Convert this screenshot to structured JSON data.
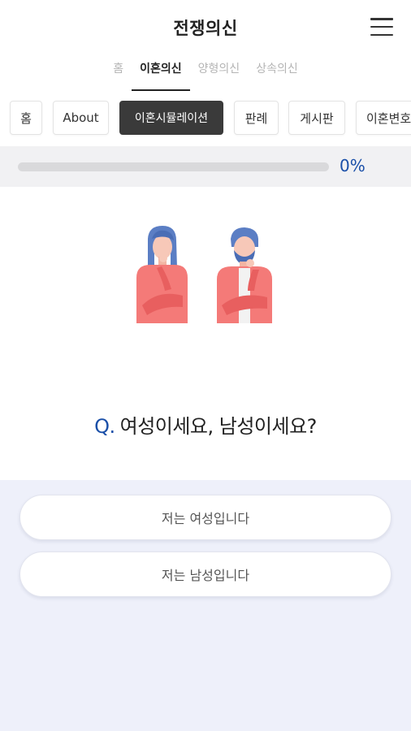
{
  "header": {
    "title": "전쟁의신",
    "menu_icon": "hamburger-menu-icon"
  },
  "category_tabs": [
    {
      "label": "홈",
      "active": false
    },
    {
      "label": "이혼의신",
      "active": true
    },
    {
      "label": "양형의신",
      "active": false
    },
    {
      "label": "상속의신",
      "active": false
    }
  ],
  "sub_nav": [
    {
      "label": "홈",
      "active": false
    },
    {
      "label": "About",
      "active": false
    },
    {
      "label": "이혼시뮬레이션",
      "active": true
    },
    {
      "label": "판례",
      "active": false
    },
    {
      "label": "게시판",
      "active": false
    },
    {
      "label": "이혼변호",
      "active": false
    }
  ],
  "progress": {
    "value": 0,
    "label": "0%"
  },
  "illustration": {
    "icon": "thinking-woman-and-man-illustration"
  },
  "question": {
    "prefix": "Q.",
    "text": "여성이세요, 남성이세요?"
  },
  "answers": [
    {
      "label": "저는 여성입니다"
    },
    {
      "label": "저는 남성입니다"
    }
  ],
  "colors": {
    "accent": "#1a4fa8",
    "active_chip": "#3a3a3a",
    "answer_area_bg": "#eef0fa",
    "illustration_shirt": "#f47a78",
    "illustration_hair": "#5b7ec4"
  }
}
